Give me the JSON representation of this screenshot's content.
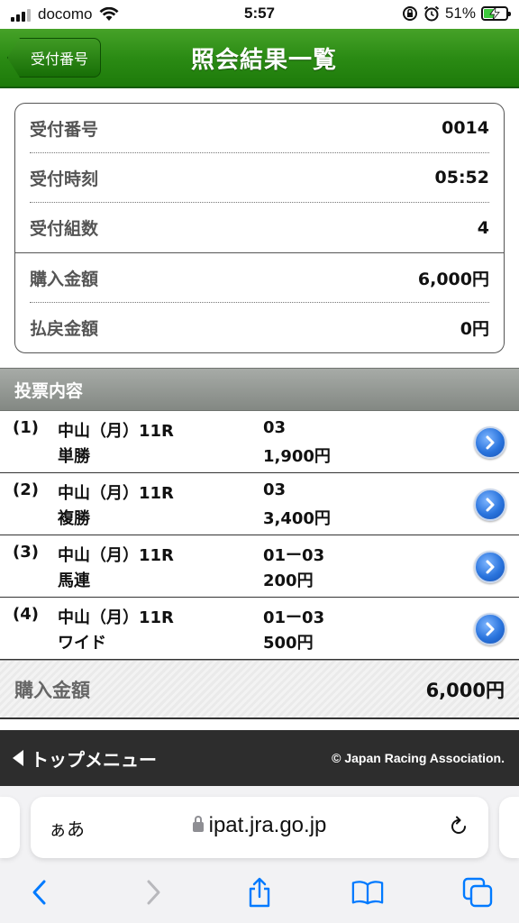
{
  "status_bar": {
    "carrier": "docomo",
    "time": "5:57",
    "battery_percent": "51%",
    "battery_level": 0.51
  },
  "header": {
    "back_label": "受付番号",
    "title": "照会結果一覧"
  },
  "summary": {
    "rows": [
      {
        "label": "受付番号",
        "value": "0014"
      },
      {
        "label": "受付時刻",
        "value": "05:52"
      },
      {
        "label": "受付組数",
        "value": "4"
      },
      {
        "label": "購入金額",
        "value": "6,000円"
      },
      {
        "label": "払戻金額",
        "value": "0円"
      }
    ]
  },
  "section": {
    "title": "投票内容"
  },
  "tickets": [
    {
      "num": "(1)",
      "race": "中山（月）11R",
      "type": "単勝",
      "combo": "03",
      "amount": "1,900円"
    },
    {
      "num": "(2)",
      "race": "中山（月）11R",
      "type": "複勝",
      "combo": "03",
      "amount": "3,400円"
    },
    {
      "num": "(3)",
      "race": "中山（月）11R",
      "type": "馬連",
      "combo": "01ー03",
      "amount": "200円"
    },
    {
      "num": "(4)",
      "race": "中山（月）11R",
      "type": "ワイド",
      "combo": "01ー03",
      "amount": "500円"
    }
  ],
  "total": {
    "label": "購入金額",
    "value": "6,000円"
  },
  "footer": {
    "top_menu_label": "トップメニュー",
    "copyright": "© Japan Racing Association."
  },
  "browser": {
    "aa_label": "ぁあ",
    "url": "ipat.jra.go.jp"
  },
  "colors": {
    "header_green": "#2b8b14",
    "section_gray": "#959a95",
    "footer_dark": "#2d2d2d",
    "ios_blue": "#007aff",
    "arrow_blue": "#2a74dd"
  }
}
